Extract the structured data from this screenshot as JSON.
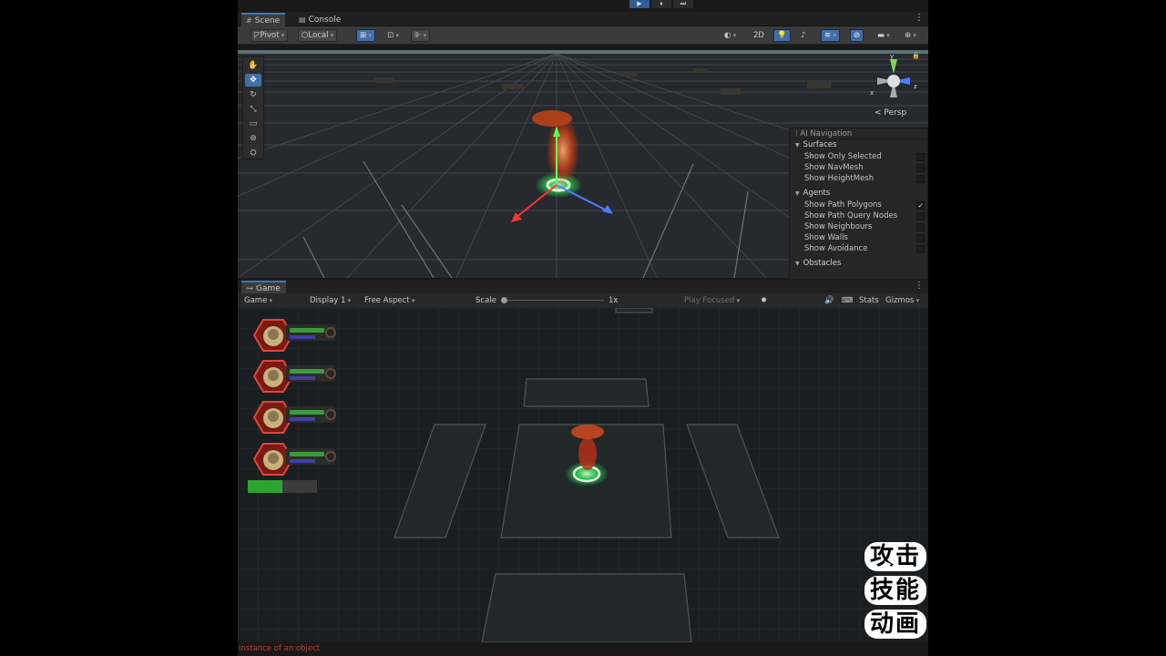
{
  "play_controls": {
    "play": "▶",
    "pause": "⏸",
    "step": "⏭"
  },
  "scene_window": {
    "tabs": [
      {
        "label": "Scene",
        "icon": "grid-icon"
      },
      {
        "label": "Console",
        "icon": "console-icon"
      }
    ],
    "toolbar": {
      "pivot_label": "Pivot",
      "space_label": "Local",
      "mode_2d_label": "2D"
    },
    "tools": [
      "hand-tool",
      "move-tool",
      "rotate-tool",
      "scale-tool",
      "rect-tool",
      "transform-tool",
      "custom-tool"
    ],
    "gizmo": {
      "projection_label": "Persp",
      "axis_x": "x",
      "axis_y": "y",
      "axis_z": "z"
    },
    "ai_navigation": {
      "title": "AI Navigation",
      "sections": [
        {
          "title": "Surfaces",
          "rows": [
            {
              "label": "Show Only Selected",
              "checked": false
            },
            {
              "label": "Show NavMesh",
              "checked": false
            },
            {
              "label": "Show HeightMesh",
              "checked": false
            }
          ]
        },
        {
          "title": "Agents",
          "rows": [
            {
              "label": "Show Path Polygons",
              "checked": true
            },
            {
              "label": "Show Path Query Nodes",
              "checked": false
            },
            {
              "label": "Show Neighbours",
              "checked": false
            },
            {
              "label": "Show Walls",
              "checked": false
            },
            {
              "label": "Show Avoidance",
              "checked": false
            }
          ]
        },
        {
          "title": "Obstacles",
          "rows": []
        }
      ]
    }
  },
  "game_window": {
    "tab_label": "Game",
    "toolbar": {
      "view_select": "Game",
      "display_select": "Display 1",
      "aspect_select": "Free Aspect",
      "scale_label": "Scale",
      "scale_value": "1x",
      "play_mode_select": "Play Focused",
      "stats_label": "Stats",
      "gizmos_label": "Gizmos"
    },
    "party_count": 4,
    "party": [
      {
        "hp": 0.95,
        "mp": 0.7
      },
      {
        "hp": 0.95,
        "mp": 0.7
      },
      {
        "hp": 0.95,
        "mp": 0.7
      },
      {
        "hp": 0.95,
        "mp": 0.7
      }
    ],
    "progress": 0.5
  },
  "watermark_text": [
    "攻击",
    "技能",
    "动画"
  ],
  "status_bar": {
    "message": "instance of an object"
  },
  "colors": {
    "accent": "#3a79bb",
    "error_text": "#c23c3c",
    "hp": "#3b9a3b",
    "mp": "#3f3fa6",
    "progress": "#2fa32f",
    "aura": "#2bff5a"
  }
}
